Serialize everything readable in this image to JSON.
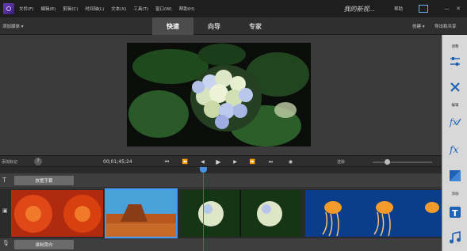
{
  "menubar": {
    "menus": [
      "文件(F)",
      "编辑(E)",
      "剪辑(C)",
      "时间轴(L)",
      "文本(X)",
      "工具(T)",
      "窗口(W)",
      "帮助(H)"
    ],
    "brand": "我的新视...",
    "help_link": "帮助"
  },
  "modebar": {
    "add_media": "添加媒体 ▾",
    "tabs": [
      {
        "label": "快速",
        "active": true
      },
      {
        "label": "向导",
        "active": false
      },
      {
        "label": "专家",
        "active": false
      }
    ],
    "create": "创建 ▾",
    "publish": "导出和共享"
  },
  "right_panel": {
    "sections": [
      "调整",
      "编辑",
      "添加"
    ],
    "tools": [
      "adjust-sliders-icon",
      "tools-icon",
      "effects-icon",
      "fx-icon",
      "transitions-icon",
      "title-text-icon",
      "music-icon"
    ]
  },
  "playback": {
    "add_marker": "添加标记",
    "help": "?",
    "timecode": "00;01;45;24",
    "render": "渲染"
  },
  "timeline": {
    "title_track": "放置字幕",
    "narration_track": "录制旁白"
  },
  "colors": {
    "accent": "#3f9bff",
    "playhead": "#e03030",
    "panel_bg": "#3a3a3a"
  }
}
